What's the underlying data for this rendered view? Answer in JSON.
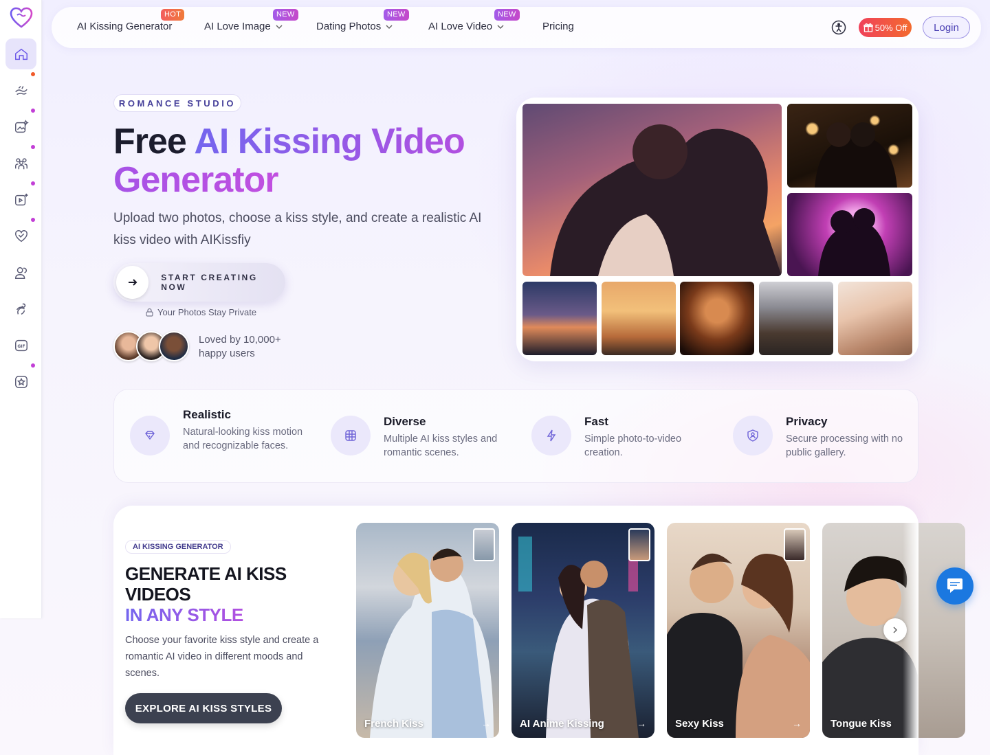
{
  "nav": {
    "items": [
      {
        "label": "AI Kissing Generator",
        "badge": "HOT"
      },
      {
        "label": "AI Love Image",
        "badge": "NEW"
      },
      {
        "label": "Dating Photos",
        "badge": "NEW"
      },
      {
        "label": "AI Love Video",
        "badge": "NEW"
      },
      {
        "label": "Pricing"
      }
    ],
    "offer_label": "50% Off",
    "login_label": "Login"
  },
  "sidebar": {
    "items": [
      {
        "icon": "home-icon",
        "active": true
      },
      {
        "icon": "kiss-icon",
        "dot": "orange"
      },
      {
        "icon": "sparkle-image-icon",
        "dot": "purple"
      },
      {
        "icon": "group-icon",
        "dot": "purple"
      },
      {
        "icon": "video-add-icon",
        "dot": "purple"
      },
      {
        "icon": "heart-check-icon",
        "dot": "purple"
      },
      {
        "icon": "couple-icon"
      },
      {
        "icon": "hug-icon"
      },
      {
        "icon": "gif-icon"
      },
      {
        "icon": "star-badge-icon",
        "dot": "purple"
      }
    ]
  },
  "hero": {
    "eyebrow": "ROMANCE STUDIO",
    "title_1": "Free ",
    "title_2": "AI Kissing Video",
    "title_3": "Generator",
    "subtitle": "Upload two photos, choose a kiss style, and create a realistic AI kiss video with AIKissfiy",
    "cta_label": "START CREATING NOW",
    "privacy": "Your Photos Stay Private",
    "loved": "Loved by 10,000+ happy users"
  },
  "features": [
    {
      "title": "Realistic",
      "desc": "Natural-looking kiss motion and recognizable faces.",
      "icon": "diamond-icon"
    },
    {
      "title": "Diverse",
      "desc": "Multiple AI kiss styles and romantic scenes.",
      "icon": "film-icon"
    },
    {
      "title": "Fast",
      "desc": "Simple photo-to-video creation.",
      "icon": "lightning-icon"
    },
    {
      "title": "Privacy",
      "desc": "Secure processing with no public gallery.",
      "icon": "shield-user-icon"
    }
  ],
  "styles_section": {
    "tag": "AI KISSING GENERATOR",
    "title_1": "GENERATE AI KISS VIDEOS",
    "title_2": "IN ANY STYLE",
    "desc": "Choose your favorite kiss style and create a romantic AI video in different moods and scenes.",
    "button": "EXPLORE AI KISS STYLES",
    "cards": [
      {
        "label": "French Kiss"
      },
      {
        "label": "AI Anime Kissing"
      },
      {
        "label": "Sexy Kiss"
      },
      {
        "label": "Tongue Kiss"
      }
    ]
  },
  "colors": {
    "accent": "#7466ee",
    "accent2": "#b14fe0",
    "hot": "#f25d5d",
    "chat": "#1b78e0"
  }
}
